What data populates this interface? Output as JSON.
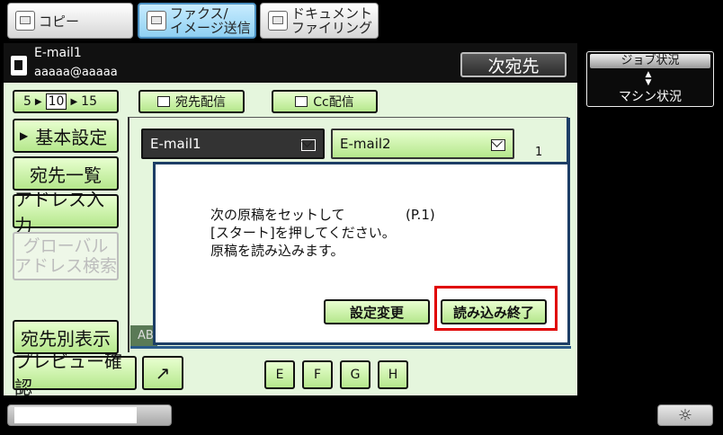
{
  "tabs": [
    {
      "label": "コピー",
      "icon": "copy-icon",
      "active": false
    },
    {
      "label_line1": "ファクス/",
      "label_line2": "イメージ送信",
      "icon": "fax-scan-icon",
      "active": true
    },
    {
      "label_line1": "ドキュメント",
      "label_line2": "ファイリング",
      "icon": "document-filing-icon",
      "active": false
    }
  ],
  "header": {
    "name": "E-mail1",
    "address": "aaaaa@aaaaa",
    "next_button": "次宛先"
  },
  "right_panel": {
    "job_status": "ジョブ状況",
    "machine_status": "マシン状況",
    "toggle_icon": "up-down-triangle-icon"
  },
  "view_count": {
    "opt1": "5",
    "opt2": "10",
    "opt3": "15",
    "selected": "10"
  },
  "delivery": {
    "to": "宛先配信",
    "cc": "Cc配信"
  },
  "sidebar": {
    "basic_settings": "基本設定",
    "address_list": "宛先一覧",
    "address_input": "アドレス入力",
    "global_search_line1": "グローバル",
    "global_search_line2": "アドレス検索",
    "dest_view": "宛先別表示",
    "preview_confirm": "プレビュー確認"
  },
  "address_entries": [
    {
      "label": "E-mail1",
      "selected": true
    },
    {
      "label": "E-mail2",
      "selected": false
    }
  ],
  "page_number": "1",
  "index_tab_partial": "AB",
  "letter_tabs": [
    "E",
    "F",
    "G",
    "H"
  ],
  "dialog": {
    "line1": "次の原稿をセットして",
    "page_label": "(P.1)",
    "line2": "[スタート]を押してください。",
    "line3": "原稿を読み込みます。",
    "settings_button": "設定変更",
    "finish_button": "読み込み終了"
  },
  "colors": {
    "panel_bg": "#e5f6dd",
    "button_green": "#b5e78c",
    "highlight": "#e00000",
    "dialog_border": "#1d3e66"
  }
}
